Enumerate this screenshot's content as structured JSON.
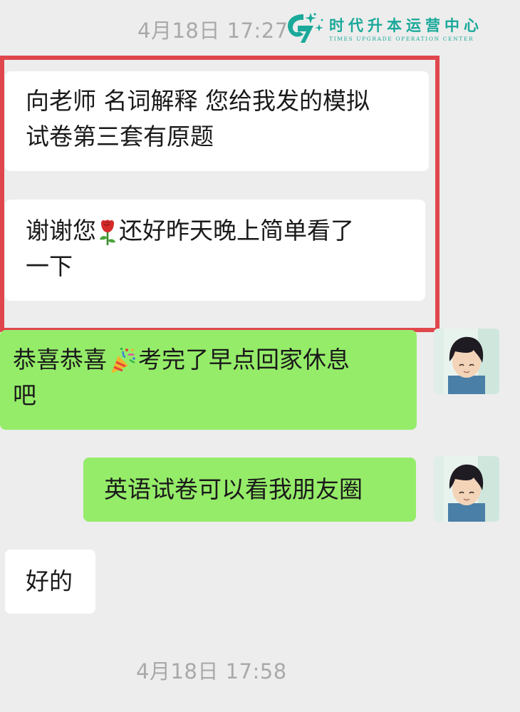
{
  "timestamps": {
    "top": "4月18日 17:27",
    "bottom": "4月18日 17:58"
  },
  "watermark": {
    "name": "时代升本运营中心",
    "subtitle": "TIMES UPGRADE OPERATION CENTER",
    "color": "#1aa99a"
  },
  "colors": {
    "background": "#ededed",
    "incoming_bubble": "#ffffff",
    "outgoing_bubble": "#95ec69",
    "highlight_border": "#e0474c",
    "timestamp_text": "#a9a9a9"
  },
  "messages": [
    {
      "side": "incoming",
      "line1": "向老师 名词解释 您给我发的模拟",
      "line2": "试卷第三套有原题"
    },
    {
      "side": "incoming",
      "before_emoji": "谢谢您",
      "emoji": "rose-emoji",
      "after_emoji": "还好昨天晚上简单看了",
      "line2": "一下"
    },
    {
      "side": "outgoing",
      "before_emoji": "恭喜恭喜",
      "emoji": "party-popper-emoji",
      "after_emoji": "考完了早点回家休息",
      "line2": "吧"
    },
    {
      "side": "outgoing",
      "text": "英语试卷可以看我朋友圈"
    },
    {
      "side": "incoming",
      "text": "好的"
    }
  ]
}
